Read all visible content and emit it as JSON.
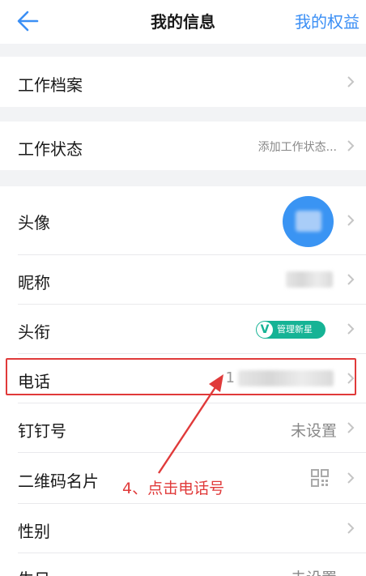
{
  "header": {
    "title": "我的信息",
    "right_link": "我的权益",
    "back_icon": "arrow-left-icon",
    "accent_color": "#3b8ff5"
  },
  "rows": {
    "work_file": {
      "label": "工作档案"
    },
    "work_status": {
      "label": "工作状态",
      "value": "添加工作状态..."
    },
    "avatar": {
      "label": "头像"
    },
    "nickname": {
      "label": "昵称"
    },
    "title": {
      "label": "头衔",
      "badge_letter": "V",
      "badge_text": "管理新星"
    },
    "phone": {
      "label": "电话",
      "value_visible_prefix": "1"
    },
    "dingtalk_id": {
      "label": "钉钉号",
      "value": "未设置"
    },
    "qr_card": {
      "label": "二维码名片"
    },
    "gender": {
      "label": "性别"
    },
    "birthday": {
      "label": "生日",
      "value": "未设置"
    }
  },
  "annotation": {
    "text": "4、点击电话号",
    "color": "#e03a3a"
  }
}
